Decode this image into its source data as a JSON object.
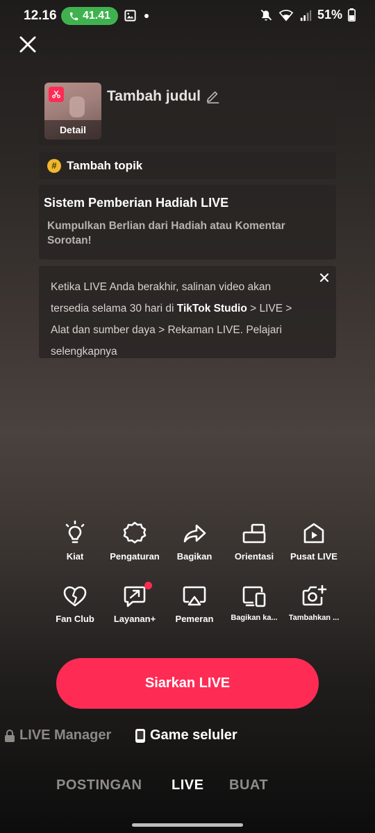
{
  "status_bar": {
    "time": "12.16",
    "call_timer": "41.41",
    "battery": "51%"
  },
  "setup": {
    "thumbnail_label": "Detail",
    "title_placeholder": "Tambah judul",
    "topic_label": "Tambah topik",
    "gift_title": "Sistem Pemberian Hadiah LIVE",
    "gift_desc": "Kumpulkan Berlian dari Hadiah atau Komentar Sorotan!",
    "info_part1": "Ketika LIVE Anda berakhir, salinan video akan tersedia selama 30 hari di ",
    "info_bold1": "TikTok Studio",
    "info_part2": " > LIVE > Alat dan sumber daya > Rekaman LIVE. ",
    "info_link": "Pelajari selengkapnya"
  },
  "tools": {
    "row1": [
      "Kiat",
      "Pengaturan",
      "Bagikan",
      "Orientasi",
      "Pusat LIVE"
    ],
    "row2": [
      "Fan Club",
      "Layanan+",
      "Pemeran",
      "Bagikan ka...",
      "Tambahkan ..."
    ]
  },
  "actions": {
    "go_live": "Siarkan LIVE"
  },
  "modes": {
    "live_manager": "LIVE Manager",
    "mobile_game": "Game seluler"
  },
  "tabs": [
    "POSTINGAN",
    "LIVE",
    "BUAT"
  ],
  "colors": {
    "accent": "#fe2c55",
    "call_pill": "#3fb24f",
    "topic_badge": "#f0b72f"
  }
}
